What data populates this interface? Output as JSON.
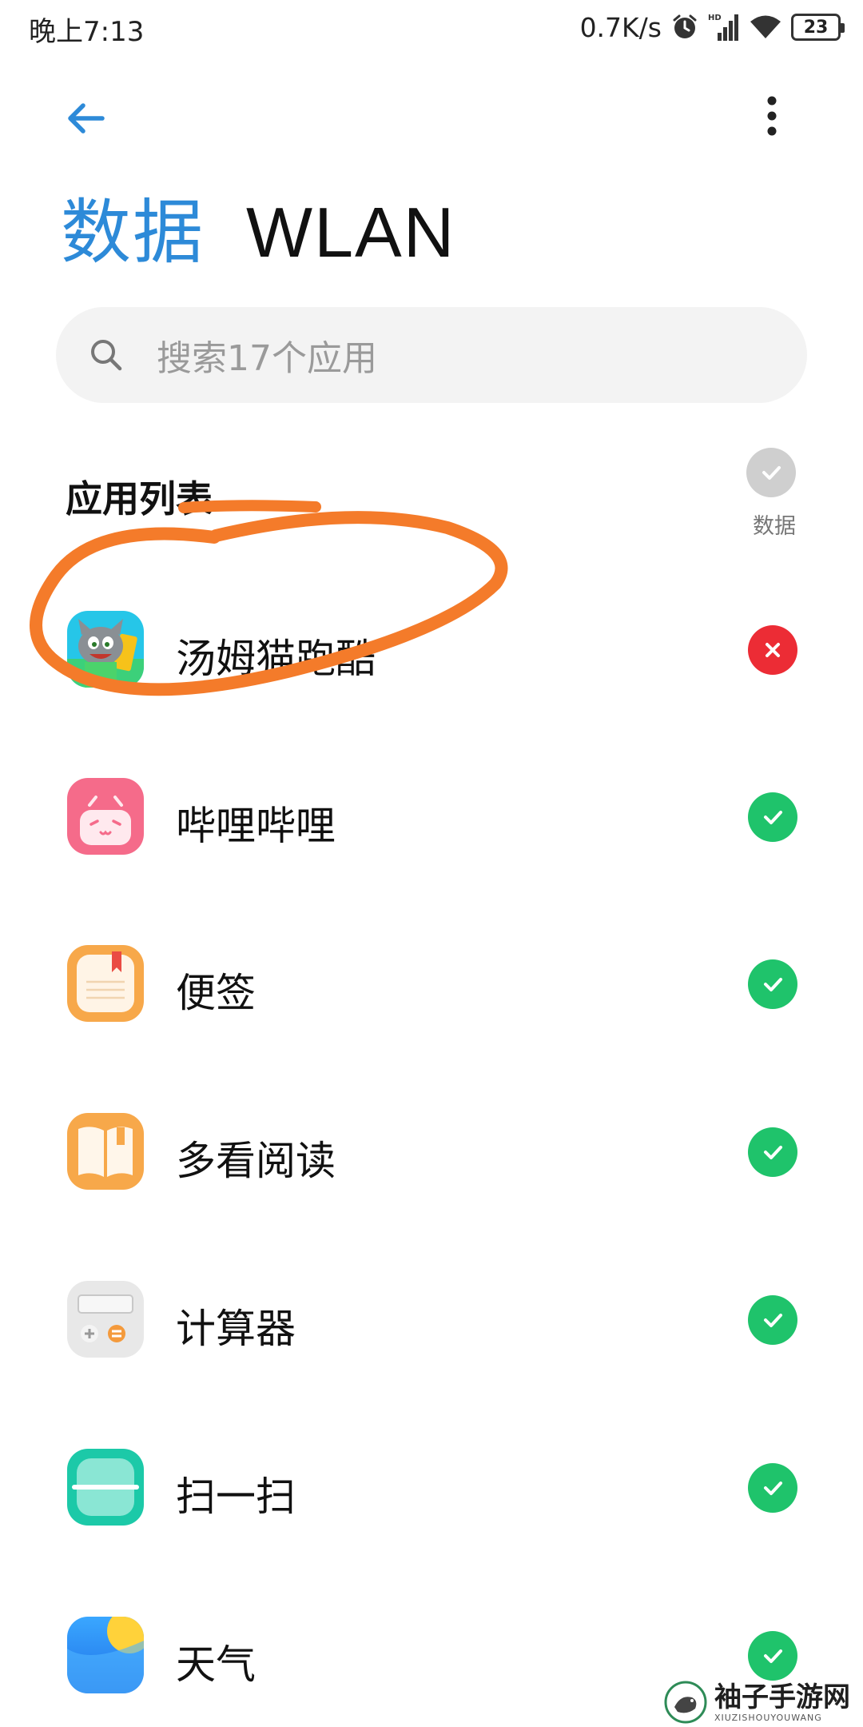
{
  "status_bar": {
    "time": "晚上7:13",
    "net_speed": "0.7K/s",
    "battery": "23",
    "icons": [
      "alarm-icon",
      "signal-hd-icon",
      "wifi-icon",
      "battery-icon"
    ]
  },
  "header": {
    "tabs": [
      {
        "label": "数据",
        "active": true
      },
      {
        "label": "WLAN",
        "active": false
      }
    ]
  },
  "search": {
    "placeholder": "搜索17个应用"
  },
  "list": {
    "title": "应用列表",
    "column_label": "数据"
  },
  "apps": [
    {
      "name": "汤姆猫跑酷",
      "icon": "talking-tom-icon",
      "enabled": false
    },
    {
      "name": "哔哩哔哩",
      "icon": "bilibili-icon",
      "enabled": true
    },
    {
      "name": "便签",
      "icon": "notes-icon",
      "enabled": true
    },
    {
      "name": "多看阅读",
      "icon": "duokan-reader-icon",
      "enabled": true
    },
    {
      "name": "计算器",
      "icon": "calculator-icon",
      "enabled": true
    },
    {
      "name": "扫一扫",
      "icon": "scanner-icon",
      "enabled": true
    },
    {
      "name": "天气",
      "icon": "weather-icon",
      "enabled": true
    }
  ],
  "watermark": {
    "main": "袖子手游网",
    "sub": "XIUZISHOUYOUWANG"
  },
  "colors": {
    "accent": "#2d8ad8",
    "enabled": "#1fc36b",
    "disabled": "#ec2c35",
    "annotation": "#f47b2a"
  }
}
